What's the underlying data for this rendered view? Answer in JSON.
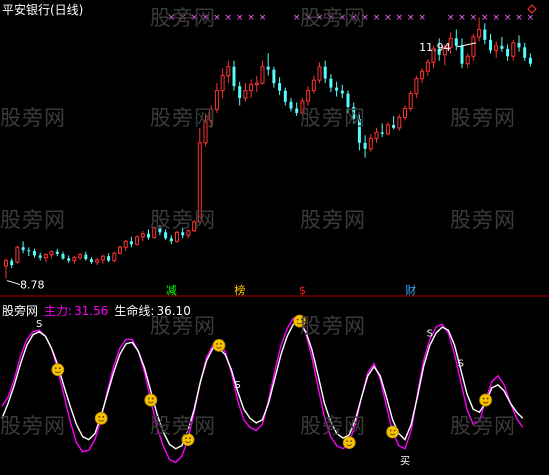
{
  "top_panel": {
    "title": "平安银行(日线)",
    "high_label": "11.94",
    "low_label": "8.78",
    "signal_labels": [
      {
        "text": "减",
        "color": "#00ff00"
      },
      {
        "text": "榜",
        "color": "#ffcc00"
      },
      {
        "text": "$",
        "color": "#ff2222"
      },
      {
        "text": "财",
        "color": "#33aaff"
      }
    ],
    "cross_marker": "×"
  },
  "indicator_panel": {
    "label": "股旁网",
    "main_label": "主力:",
    "main_value": "31.56",
    "life_label": "生命线:",
    "life_value": "36.10",
    "marker_s": "S",
    "marker_buy": "买"
  },
  "watermark": "股旁网",
  "colors": {
    "up": "#ff3232",
    "down": "#54fcfc",
    "main_line": "#ff00ff",
    "life_line": "#ffffff",
    "cross": "#ff66ff",
    "background": "#000000"
  },
  "icons": [
    "smiley-icon",
    "diamond-icon"
  ],
  "chart_data": [
    {
      "type": "candlestick",
      "title": "平安银行(日线)",
      "ylim": [
        8.6,
        12.3
      ],
      "annotations": [
        {
          "text": "11.94",
          "value": 11.94
        },
        {
          "text": "8.78",
          "value": 8.78
        }
      ],
      "candles": [
        [
          8.95,
          9.05,
          8.78,
          9.02
        ],
        [
          9.02,
          9.05,
          8.92,
          8.96
        ],
        [
          9.0,
          9.22,
          8.98,
          9.2
        ],
        [
          9.2,
          9.28,
          9.12,
          9.16
        ],
        [
          9.16,
          9.2,
          9.08,
          9.15
        ],
        [
          9.15,
          9.18,
          9.06,
          9.09
        ],
        [
          9.09,
          9.13,
          9.02,
          9.06
        ],
        [
          9.06,
          9.12,
          9.0,
          9.1
        ],
        [
          9.1,
          9.16,
          9.05,
          9.14
        ],
        [
          9.14,
          9.18,
          9.08,
          9.11
        ],
        [
          9.11,
          9.14,
          9.03,
          9.05
        ],
        [
          9.05,
          9.09,
          8.99,
          9.02
        ],
        [
          9.02,
          9.08,
          8.98,
          9.06
        ],
        [
          9.06,
          9.12,
          9.03,
          9.1
        ],
        [
          9.1,
          9.14,
          9.02,
          9.04
        ],
        [
          9.04,
          9.07,
          8.98,
          9.0
        ],
        [
          9.0,
          9.06,
          8.96,
          9.03
        ],
        [
          9.03,
          9.1,
          8.98,
          9.08
        ],
        [
          9.08,
          9.12,
          9.0,
          9.02
        ],
        [
          9.02,
          9.14,
          9.0,
          9.12
        ],
        [
          9.12,
          9.22,
          9.1,
          9.2
        ],
        [
          9.2,
          9.3,
          9.15,
          9.28
        ],
        [
          9.28,
          9.34,
          9.2,
          9.24
        ],
        [
          9.24,
          9.36,
          9.22,
          9.34
        ],
        [
          9.34,
          9.42,
          9.28,
          9.38
        ],
        [
          9.38,
          9.44,
          9.3,
          9.33
        ],
        [
          9.33,
          9.48,
          9.32,
          9.46
        ],
        [
          9.46,
          9.5,
          9.36,
          9.4
        ],
        [
          9.4,
          9.44,
          9.3,
          9.32
        ],
        [
          9.32,
          9.36,
          9.24,
          9.28
        ],
        [
          9.28,
          9.42,
          9.26,
          9.4
        ],
        [
          9.4,
          9.46,
          9.32,
          9.36
        ],
        [
          9.36,
          9.44,
          9.32,
          9.42
        ],
        [
          9.42,
          9.56,
          9.4,
          9.54
        ],
        [
          9.54,
          10.8,
          9.5,
          10.6
        ],
        [
          10.6,
          11.0,
          10.55,
          10.9
        ],
        [
          10.9,
          11.1,
          10.8,
          11.05
        ],
        [
          11.05,
          11.4,
          11.0,
          11.3
        ],
        [
          11.3,
          11.6,
          11.2,
          11.5
        ],
        [
          11.5,
          11.7,
          11.4,
          11.62
        ],
        [
          11.62,
          11.7,
          11.3,
          11.36
        ],
        [
          11.36,
          11.42,
          11.1,
          11.2
        ],
        [
          11.2,
          11.4,
          11.15,
          11.3
        ],
        [
          11.3,
          11.45,
          11.2,
          11.38
        ],
        [
          11.38,
          11.5,
          11.28,
          11.4
        ],
        [
          11.4,
          11.7,
          11.38,
          11.62
        ],
        [
          11.62,
          11.8,
          11.5,
          11.58
        ],
        [
          11.58,
          11.62,
          11.34,
          11.4
        ],
        [
          11.4,
          11.48,
          11.24,
          11.3
        ],
        [
          11.3,
          11.34,
          11.1,
          11.15
        ],
        [
          11.15,
          11.2,
          11.02,
          11.06
        ],
        [
          11.06,
          11.14,
          10.96,
          11.0
        ],
        [
          11.0,
          11.2,
          10.98,
          11.16
        ],
        [
          11.16,
          11.36,
          11.1,
          11.3
        ],
        [
          11.3,
          11.5,
          11.26,
          11.44
        ],
        [
          11.44,
          11.68,
          11.4,
          11.62
        ],
        [
          11.62,
          11.7,
          11.4,
          11.46
        ],
        [
          11.46,
          11.52,
          11.28,
          11.34
        ],
        [
          11.34,
          11.42,
          11.22,
          11.3
        ],
        [
          11.3,
          11.38,
          11.2,
          11.26
        ],
        [
          11.26,
          11.3,
          11.0,
          11.08
        ],
        [
          11.08,
          11.14,
          10.86,
          10.92
        ],
        [
          10.92,
          10.98,
          10.5,
          10.6
        ],
        [
          10.6,
          10.7,
          10.4,
          10.52
        ],
        [
          10.52,
          10.72,
          10.48,
          10.66
        ],
        [
          10.66,
          10.8,
          10.6,
          10.74
        ],
        [
          10.74,
          10.86,
          10.68,
          10.72
        ],
        [
          10.72,
          10.88,
          10.7,
          10.84
        ],
        [
          10.84,
          10.96,
          10.78,
          10.8
        ],
        [
          10.8,
          10.98,
          10.76,
          10.94
        ],
        [
          10.94,
          11.1,
          10.9,
          11.06
        ],
        [
          11.06,
          11.3,
          11.02,
          11.26
        ],
        [
          11.26,
          11.5,
          11.2,
          11.46
        ],
        [
          11.46,
          11.6,
          11.4,
          11.56
        ],
        [
          11.56,
          11.72,
          11.5,
          11.68
        ],
        [
          11.68,
          11.9,
          11.6,
          11.86
        ],
        [
          11.86,
          12.0,
          11.7,
          11.78
        ],
        [
          11.78,
          11.92,
          11.64,
          11.88
        ],
        [
          11.88,
          12.08,
          11.8,
          12.0
        ],
        [
          12.0,
          12.12,
          11.84,
          11.9
        ],
        [
          11.9,
          12.0,
          11.6,
          11.66
        ],
        [
          11.66,
          11.8,
          11.6,
          11.76
        ],
        [
          11.76,
          12.06,
          11.7,
          12.02
        ],
        [
          12.02,
          12.28,
          11.96,
          12.12
        ],
        [
          12.12,
          12.2,
          11.92,
          11.98
        ],
        [
          11.98,
          12.06,
          11.8,
          11.84
        ],
        [
          11.84,
          11.96,
          11.74,
          11.9
        ],
        [
          11.9,
          12.02,
          11.82,
          11.86
        ],
        [
          11.86,
          11.92,
          11.7,
          11.76
        ],
        [
          11.76,
          11.98,
          11.7,
          11.94
        ],
        [
          11.94,
          12.04,
          11.82,
          11.88
        ],
        [
          11.88,
          11.94,
          11.7,
          11.74
        ],
        [
          11.74,
          11.8,
          11.62,
          11.66
        ]
      ],
      "signals": [
        {
          "label": "减",
          "index": 29
        },
        {
          "label": "榜",
          "index": 41
        },
        {
          "label": "$",
          "index": 52
        },
        {
          "label": "财",
          "index": 71
        }
      ],
      "cross_marks": [
        29,
        31,
        33,
        35,
        37,
        39,
        41,
        43,
        45,
        51,
        53,
        55,
        57,
        59,
        61,
        63,
        65,
        67,
        69,
        71,
        73,
        78,
        80,
        82,
        84,
        86,
        88,
        90,
        92
      ]
    },
    {
      "type": "line",
      "series": [
        {
          "name": "主力",
          "color": "#ff00ff",
          "current": 31.56,
          "values": [
            42,
            48,
            60,
            75,
            86,
            91,
            92,
            88,
            80,
            66,
            49,
            32,
            18,
            12,
            13,
            20,
            34,
            52,
            68,
            80,
            86,
            86,
            78,
            64,
            46,
            28,
            16,
            7,
            5,
            9,
            20,
            38,
            58,
            74,
            82,
            82,
            78,
            64,
            46,
            33,
            28,
            26,
            30,
            46,
            65,
            82,
            93,
            100,
            98,
            90,
            74,
            54,
            35,
            22,
            16,
            14,
            18,
            30,
            48,
            64,
            70,
            60,
            42,
            25,
            16,
            14,
            26,
            50,
            72,
            86,
            94,
            96,
            90,
            76,
            58,
            40,
            30,
            32,
            46,
            58,
            62,
            56,
            44,
            34,
            28
          ]
        },
        {
          "name": "生命线",
          "color": "#ffffff",
          "current": 36.1,
          "values": [
            34,
            44,
            56,
            70,
            82,
            89,
            91,
            88,
            80,
            69,
            55,
            42,
            30,
            22,
            20,
            24,
            36,
            50,
            64,
            76,
            83,
            84,
            78,
            67,
            52,
            37,
            25,
            17,
            14,
            16,
            26,
            40,
            58,
            72,
            80,
            80,
            76,
            66,
            52,
            40,
            34,
            31,
            33,
            44,
            60,
            76,
            88,
            96,
            97,
            91,
            79,
            62,
            44,
            32,
            24,
            21,
            23,
            33,
            48,
            62,
            68,
            62,
            48,
            33,
            24,
            20,
            30,
            48,
            68,
            82,
            90,
            94,
            92,
            82,
            66,
            50,
            40,
            38,
            44,
            54,
            56,
            52,
            44,
            38,
            34
          ]
        }
      ],
      "markers": [
        {
          "text": "S",
          "index": 6
        },
        {
          "text": "S",
          "index": 38
        },
        {
          "text": "S",
          "index": 69
        },
        {
          "text": "S",
          "index": 74
        },
        {
          "text": "买",
          "index": 65
        }
      ],
      "smiley_indices": [
        9,
        16,
        24,
        30,
        35,
        48,
        56,
        63,
        78
      ]
    }
  ]
}
